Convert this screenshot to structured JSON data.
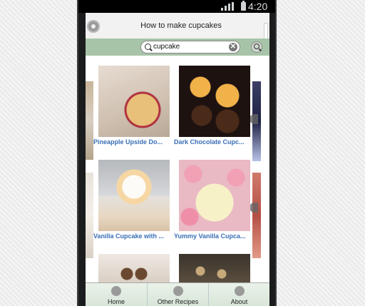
{
  "status_bar": {
    "time": "4:20"
  },
  "app": {
    "title": "How to make cupcakes"
  },
  "search": {
    "value": "cupcake",
    "clear_glyph": "✕"
  },
  "recipes": [
    {
      "label": "Pineapple Upside Do..."
    },
    {
      "label": "Dark Chocolate Cupc..."
    },
    {
      "label": "Vanilla Cupcake with ..."
    },
    {
      "label": "Yummy Vanilla Cupca..."
    }
  ],
  "tabs": [
    {
      "label": "Home",
      "icon": "home-icon"
    },
    {
      "label": "Other Recipes",
      "icon": "list-icon"
    },
    {
      "label": "About",
      "icon": "info-icon"
    }
  ],
  "colors": {
    "search_bar": "#a8c4a8",
    "caption": "#3a6fb6",
    "tab_bar": "#d7e5d7"
  }
}
